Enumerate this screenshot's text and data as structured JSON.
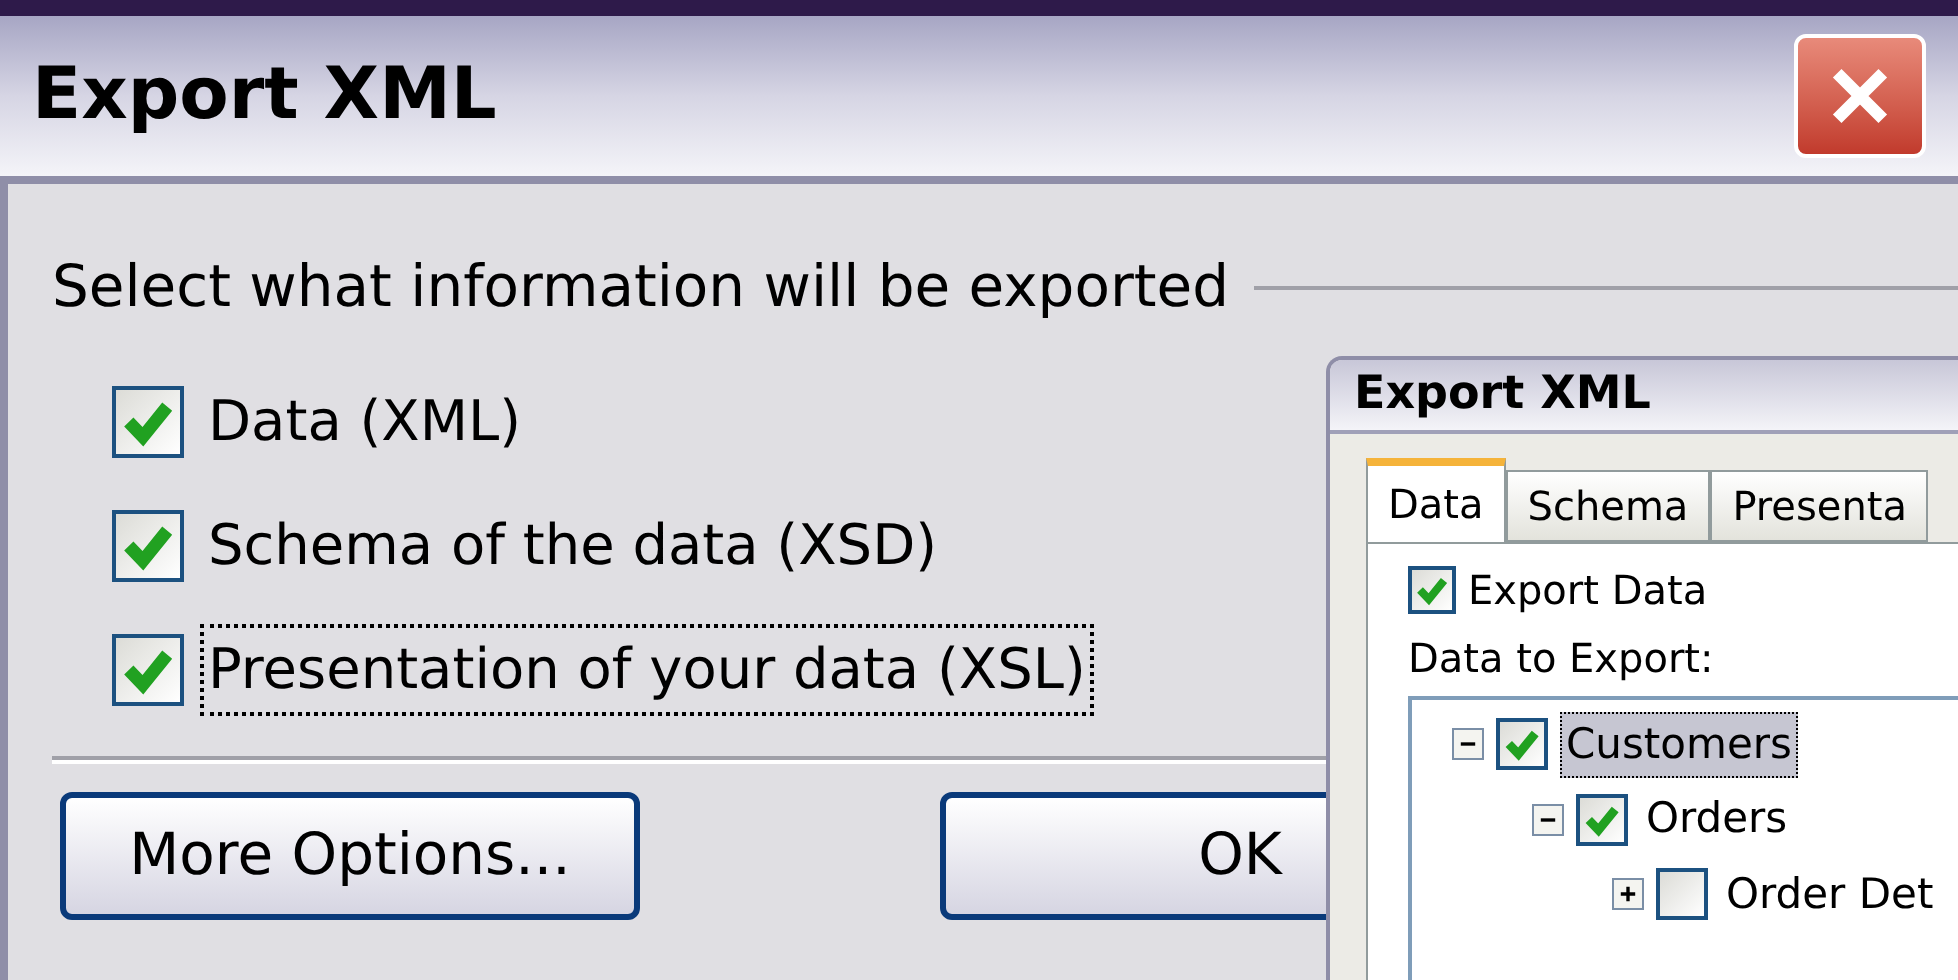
{
  "main_dialog": {
    "title": "Export XML",
    "heading": "Select what information will be exported",
    "options": [
      {
        "label": "Data (XML)",
        "checked": true,
        "focused": false
      },
      {
        "label": "Schema of the data (XSD)",
        "checked": true,
        "focused": false
      },
      {
        "label": "Presentation of your data (XSL)",
        "checked": true,
        "focused": true
      }
    ],
    "buttons": [
      "More Options...",
      "OK"
    ]
  },
  "second_dialog": {
    "title": "Export XML",
    "tabs": [
      {
        "label": "Data",
        "selected": true
      },
      {
        "label": "Schema",
        "selected": false
      },
      {
        "label": "Presenta",
        "selected": false
      }
    ],
    "export_data": {
      "label": "Export Data",
      "checked": true
    },
    "tree_label": "Data to Export:",
    "tree": [
      {
        "label": "Customers",
        "checked": true,
        "expanded": true,
        "selected": true,
        "children": [
          {
            "label": "Orders",
            "checked": true,
            "expanded": true,
            "selected": false,
            "children": [
              {
                "label": "Order Det",
                "checked": false,
                "expanded": false,
                "selected": false
              }
            ]
          }
        ]
      }
    ]
  }
}
